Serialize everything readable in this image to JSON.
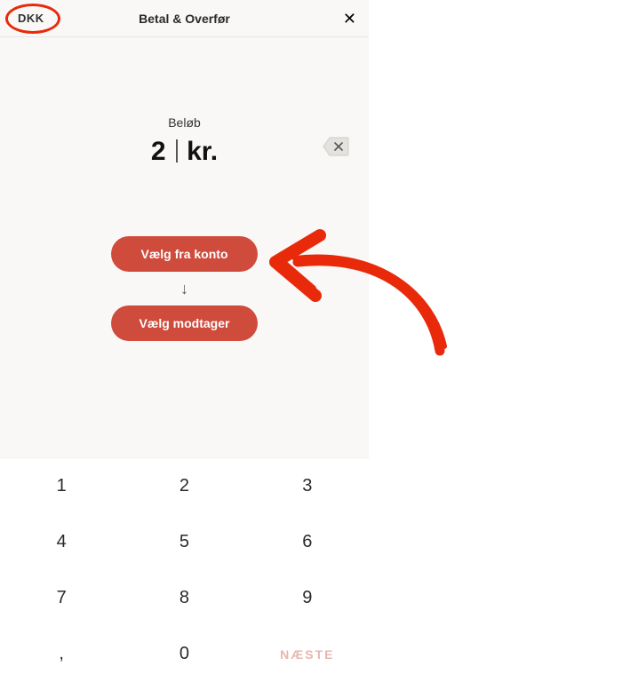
{
  "header": {
    "currency": "DKK",
    "title": "Betal & Overfør",
    "close_label": "✕"
  },
  "amount": {
    "label": "Beløb",
    "value": "2",
    "suffix": "kr."
  },
  "actions": {
    "from_account": "Vælg fra konto",
    "to_recipient": "Vælg modtager"
  },
  "keypad": {
    "k1": "1",
    "k2": "2",
    "k3": "3",
    "k4": "4",
    "k5": "5",
    "k6": "6",
    "k7": "7",
    "k8": "8",
    "k9": "9",
    "comma": ",",
    "k0": "0",
    "next": "NÆSTE"
  },
  "annotations": {
    "arrow_color": "#e82a0b"
  }
}
